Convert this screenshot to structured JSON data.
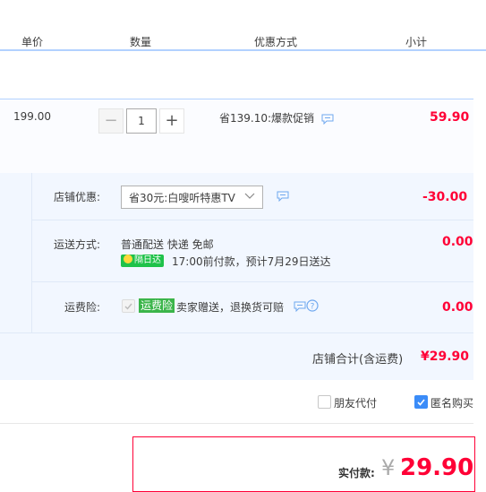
{
  "header": {
    "col_price": "单价",
    "col_qty": "数量",
    "col_discount": "优惠方式",
    "col_subtotal": "小计"
  },
  "item": {
    "unit_price": "199.00",
    "quantity": "1",
    "minus_symbol": "−",
    "plus_symbol": "+",
    "discount_text": "省139.10:爆款促销",
    "subtotal": "59.90"
  },
  "shop_discount": {
    "label": "店铺优惠:",
    "selected": "省30元:白嗖听特惠TV",
    "amount": "-30.00"
  },
  "shipping": {
    "label": "运送方式:",
    "method": "普通配送 快递 免邮",
    "badge": "隔日达",
    "promise": "17:00前付款，预计7月29日送达",
    "amount": "0.00"
  },
  "insurance": {
    "label": "运费险:",
    "badge": "运费险",
    "text": "卖家赠送，退换货可赔",
    "amount": "0.00"
  },
  "shop_total": {
    "label": "店铺合计(含运费)",
    "amount": "¥29.90"
  },
  "options": {
    "friend_pay": "朋友代付",
    "anonymous": "匿名购买",
    "anonymous_checked": true
  },
  "payment": {
    "label": "实付款:",
    "currency": "¥",
    "amount": "29.90"
  },
  "colors": {
    "accent_red": "#ff0036",
    "header_border": "#b2d1ff",
    "block_bg": "#f2f7ff",
    "check_blue": "#3b8cf8",
    "badge_green": "#1fc24a"
  }
}
